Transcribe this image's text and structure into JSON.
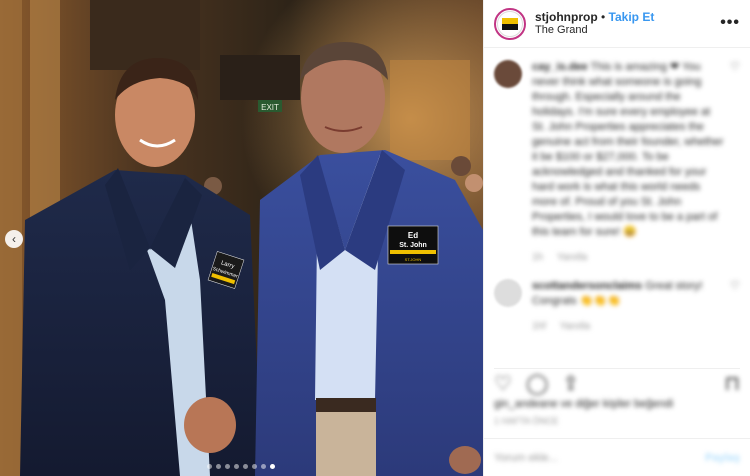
{
  "post": {
    "username": "stjohnprop",
    "separator": "•",
    "follow_label": "Takip Et",
    "location": "The Grand",
    "more_icon": "more-horizontal-icon"
  },
  "photo": {
    "badge_left_name": "Larry",
    "badge_left_name2": "Schwimmer",
    "badge_right_first": "Ed",
    "badge_right_last": "St. John",
    "badge_logo_text": "ST.JOHN",
    "exit_sign": "EXIT"
  },
  "comments": [
    {
      "author": "cay_is.dee",
      "text": "This is amazing ❤ You never think what someone is going through. Especially around the holidays. I'm sure every employee at St. John Properties appreciates the genuine act from their founder, whether it be $100 or $27,000. To be acknowledged and thanked for your hard work is what this world needs more of. Proud of you St. John Properties, I would love to be a part of this team for sure! 😀",
      "time": "1h",
      "reply": "Yanıtla"
    },
    {
      "author": "scottandersonclaims",
      "text": "Great story! Congrats 👏👏👏",
      "time": "1hf",
      "reply": "Yanıtla"
    }
  ],
  "likes_text": "gin_andeane ve diğer kişiler beğendi",
  "date_text": "1 HAFTA ÖNCE",
  "comment_placeholder": "Yorum ekle...",
  "share_label": "Paylaş",
  "carousel": {
    "count": 8,
    "active": 8
  }
}
